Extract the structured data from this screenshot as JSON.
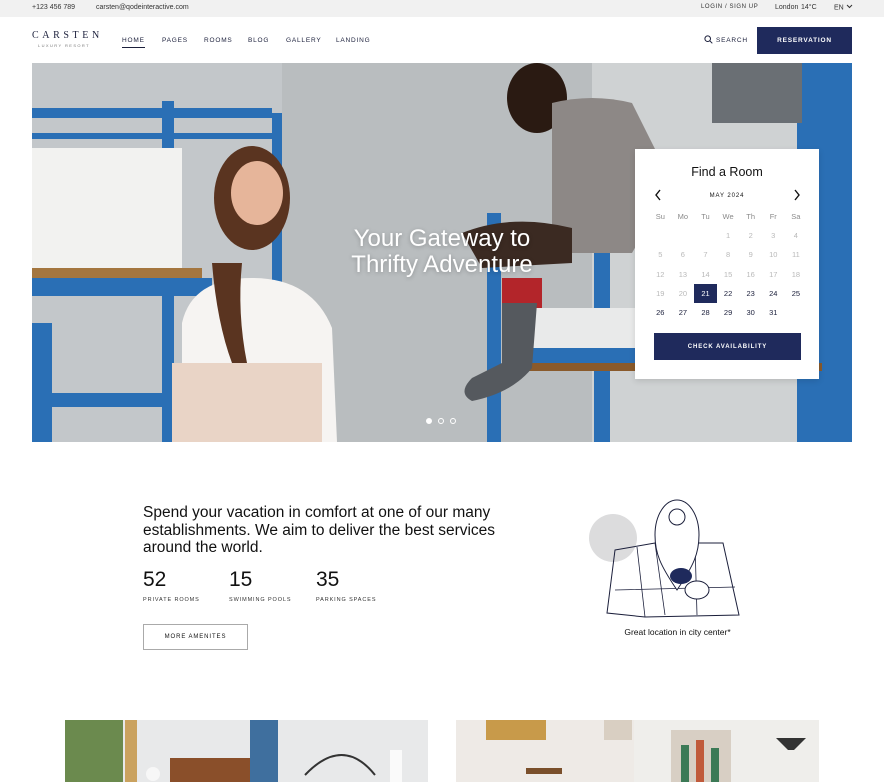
{
  "topbar": {
    "phone": "+123 456 789",
    "email": "carsten@qodeinteractive.com",
    "login": "LOGIN / SIGN UP",
    "city": "London",
    "temperature": "14°C",
    "language": "EN"
  },
  "header": {
    "logo_main": "CARSTEN",
    "logo_sub": "LUXURY RESORT",
    "nav": [
      "HOME",
      "PAGES",
      "ROOMS",
      "BLOG",
      "GALLERY",
      "LANDING"
    ],
    "search_label": "SEARCH",
    "reservation_label": "RESERVATION"
  },
  "hero": {
    "title_line1": "Your Gateway to",
    "title_line2": "Thrifty Adventure",
    "slide_count": 3,
    "active_slide": 1
  },
  "finder": {
    "title": "Find a Room",
    "month": "MAY 2024",
    "weekdays": [
      "Su",
      "Mo",
      "Tu",
      "We",
      "Th",
      "Fr",
      "Sa"
    ],
    "days": [
      [
        "",
        "",
        "",
        "1",
        "2",
        "3",
        "4"
      ],
      [
        "5",
        "6",
        "7",
        "8",
        "9",
        "10",
        "11"
      ],
      [
        "12",
        "13",
        "14",
        "15",
        "16",
        "17",
        "18"
      ],
      [
        "19",
        "20",
        "21",
        "22",
        "23",
        "24",
        "25"
      ],
      [
        "26",
        "27",
        "28",
        "29",
        "30",
        "31",
        ""
      ]
    ],
    "first_available_day": 21,
    "selected_day": "21",
    "button_label": "CHECK AVAILABILITY"
  },
  "intro": {
    "text": "Spend your vacation in comfort at one of our many establishments. We aim to deliver the best services around the world.",
    "stats": [
      {
        "value": "52",
        "label": "PRIVATE ROOMS"
      },
      {
        "value": "15",
        "label": "SWIMMING POOLS"
      },
      {
        "value": "35",
        "label": "PARKING SPACES"
      }
    ],
    "button_label": "MORE AMENITES",
    "location_caption": "Great location in city center*"
  },
  "colors": {
    "accent": "#1f2a5c",
    "topbar_bg": "#f1f1f1",
    "bed_frame": "#2a6fb5"
  },
  "icons": [
    "search-icon",
    "chevron-down-icon",
    "chevron-left-icon",
    "chevron-right-icon",
    "location-pin-icon"
  ]
}
